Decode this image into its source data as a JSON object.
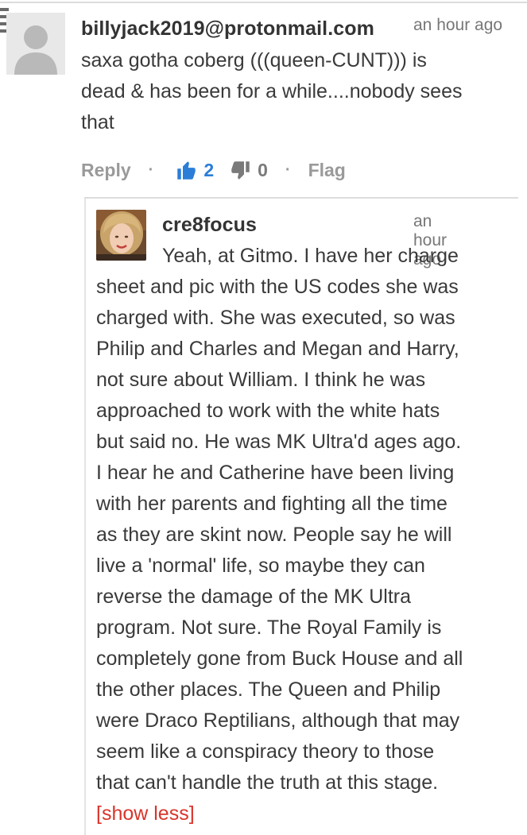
{
  "comments": [
    {
      "author": "billyjack2019@protonmail.com",
      "timestamp": "an hour ago",
      "text_lines": [
        "saxa gotha coberg (((queen-CUNT))) is",
        "dead & has been for a while....nobody sees",
        "that"
      ],
      "actions": {
        "reply_label": "Reply",
        "upvotes": "2",
        "downvotes": "0",
        "flag_label": "Flag",
        "separator": "·"
      }
    }
  ],
  "reply": {
    "author": "cre8focus",
    "timestamp": "an hour ago",
    "text_lines": [
      "Yeah, at Gitmo. I have her charge",
      "sheet and pic with the US codes she was",
      "charged with. She was executed, so was",
      "Philip and Charles and Megan and Harry,",
      "not sure about William. I think he was",
      "approached to work with the white hats",
      "but said no. He was MK Ultra'd ages ago.",
      "I hear he and Catherine have been living",
      "with her parents and fighting all the time",
      "as they are skint now. People say he will",
      "live a 'normal' life, so maybe they can",
      "reverse the damage of the MK Ultra",
      "program. Not sure. The Royal Family is",
      "completely gone from Buck House and all",
      "the other places. The Queen and Philip",
      "were Draco Reptilians, although that may",
      "seem like a conspiracy theory to those",
      "that can't handle the truth at this stage."
    ],
    "show_less_label": "[show less]"
  },
  "colors": {
    "upvote_blue": "#2b7ed8",
    "show_less_red": "#d9342b",
    "muted_gray": "#9a9a9a"
  },
  "icons": [
    "menu-icon",
    "default-avatar-icon",
    "thumbs-up-icon",
    "thumbs-down-icon"
  ]
}
